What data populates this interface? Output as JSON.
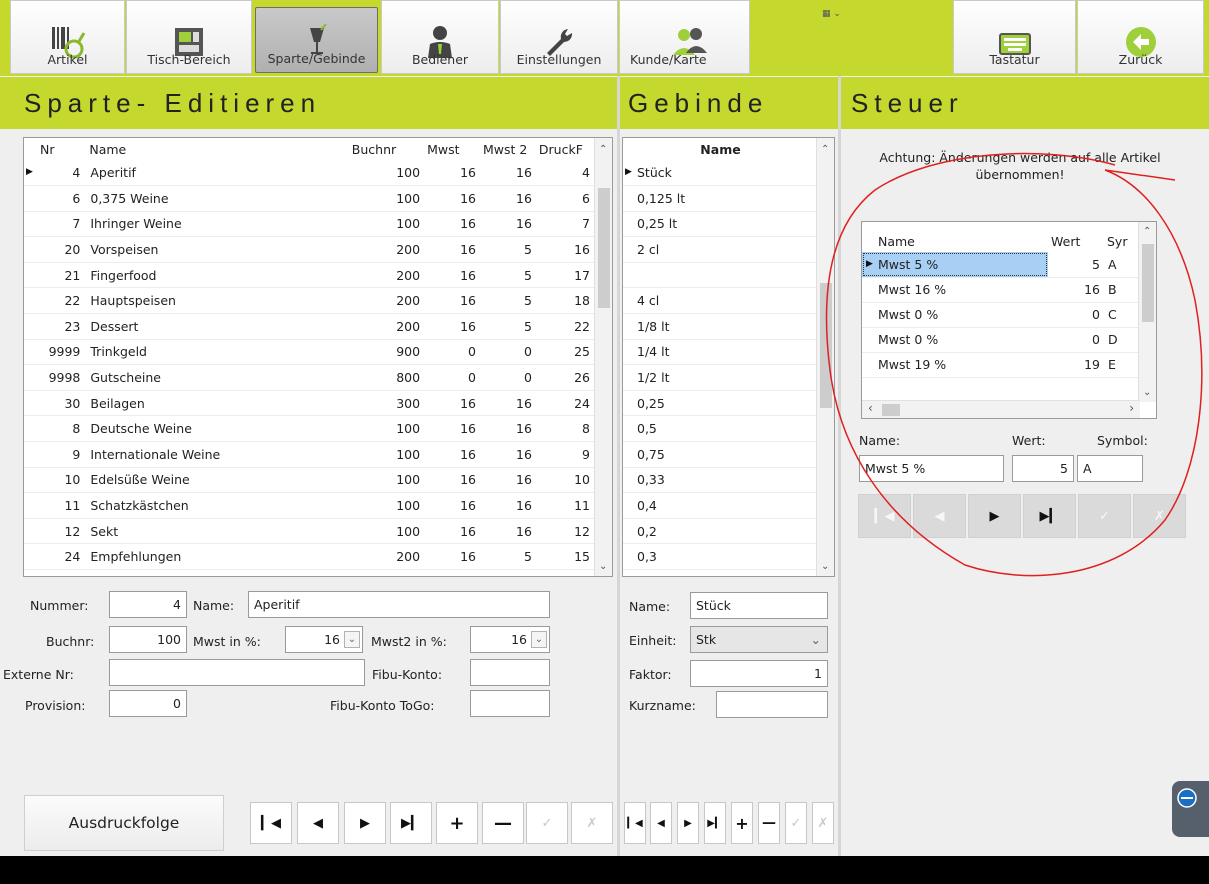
{
  "toolbar": {
    "artikel": "Artikel",
    "tisch": "Tisch-Bereich",
    "sparte": "Sparte/Gebinde",
    "bediener": "Bediener",
    "einstellungen": "Einstellungen",
    "kunde": "Kunde/Karte",
    "tastatur": "Tastatur",
    "zurueck": "Zurück"
  },
  "sections": {
    "sparte_title": "Sparte- Editieren",
    "gebinde_title": "Gebinde",
    "steuer_title": "Steuer"
  },
  "sparte_table": {
    "headers": [
      "Nr",
      "Name",
      "Buchnr",
      "Mwst",
      "Mwst 2",
      "DruckF"
    ],
    "rows": [
      [
        "4",
        "Aperitif",
        "100",
        "16",
        "16",
        "4"
      ],
      [
        "6",
        "0,375 Weine",
        "100",
        "16",
        "16",
        "6"
      ],
      [
        "7",
        "Ihringer Weine",
        "100",
        "16",
        "16",
        "7"
      ],
      [
        "20",
        "Vorspeisen",
        "200",
        "16",
        "5",
        "16"
      ],
      [
        "21",
        "Fingerfood",
        "200",
        "16",
        "5",
        "17"
      ],
      [
        "22",
        "Hauptspeisen",
        "200",
        "16",
        "5",
        "18"
      ],
      [
        "23",
        "Dessert",
        "200",
        "16",
        "5",
        "22"
      ],
      [
        "9999",
        "Trinkgeld",
        "900",
        "0",
        "0",
        "25"
      ],
      [
        "9998",
        "Gutscheine",
        "800",
        "0",
        "0",
        "26"
      ],
      [
        "30",
        "Beilagen",
        "300",
        "16",
        "16",
        "24"
      ],
      [
        "8",
        "Deutsche Weine",
        "100",
        "16",
        "16",
        "8"
      ],
      [
        "9",
        "Internationale Weine",
        "100",
        "16",
        "16",
        "9"
      ],
      [
        "10",
        "Edelsüße Weine",
        "100",
        "16",
        "16",
        "10"
      ],
      [
        "11",
        "Schatzkästchen",
        "100",
        "16",
        "16",
        "11"
      ],
      [
        "12",
        "Sekt",
        "100",
        "16",
        "16",
        "12"
      ],
      [
        "24",
        "Empfehlungen",
        "200",
        "16",
        "5",
        "15"
      ]
    ]
  },
  "sparte_form": {
    "nummer_label": "Nummer:",
    "nummer_value": "4",
    "name_label": "Name:",
    "name_value": "Aperitif",
    "buchnr_label": "Buchnr:",
    "buchnr_value": "100",
    "mwst_label": "Mwst in %:",
    "mwst_value": "16",
    "mwst2_label": "Mwst2 in %:",
    "mwst2_value": "16",
    "extern_label": "Externe Nr:",
    "extern_value": "",
    "fibu_label": "Fibu-Konto:",
    "fibu_value": "",
    "provision_label": "Provision:",
    "provision_value": "0",
    "fibu_togo_label": "Fibu-Konto ToGo:",
    "fibu_togo_value": "",
    "ausdruck_button": "Ausdruckfolge"
  },
  "gebinde_table": {
    "header": "Name",
    "rows": [
      "Stück",
      "0,125 lt",
      "0,25 lt",
      "2 cl",
      "",
      "4 cl",
      "1/8 lt",
      "1/4 lt",
      "1/2 lt",
      "0,25",
      "0,5",
      "0,75",
      "0,33",
      "0,4",
      "0,2",
      "0,3"
    ]
  },
  "gebinde_form": {
    "name_label": "Name:",
    "name_value": "Stück",
    "einheit_label": "Einheit:",
    "einheit_value": "Stk",
    "faktor_label": "Faktor:",
    "faktor_value": "1",
    "kurzname_label": "Kurzname:",
    "kurzname_value": ""
  },
  "steuer": {
    "warning": "Achtung: Änderungen werden auf alle Artikel übernommen!",
    "headers": [
      "Name",
      "Wert",
      "Syr"
    ],
    "rows": [
      [
        "Mwst 5 %",
        "5",
        "A"
      ],
      [
        "Mwst 16 %",
        "16",
        "B"
      ],
      [
        "Mwst 0 %",
        "0",
        "C"
      ],
      [
        "Mwst 0 %",
        "0",
        "D"
      ],
      [
        "Mwst 19 %",
        "19",
        "E"
      ]
    ],
    "name_label": "Name:",
    "wert_label": "Wert:",
    "symbol_label": "Symbol:",
    "name_value": "Mwst 5 %",
    "wert_value": "5",
    "symbol_value": "A"
  },
  "colors": {
    "accent": "#c4d82d",
    "selection": "#a8d0f5",
    "annotation": "#e02020"
  }
}
